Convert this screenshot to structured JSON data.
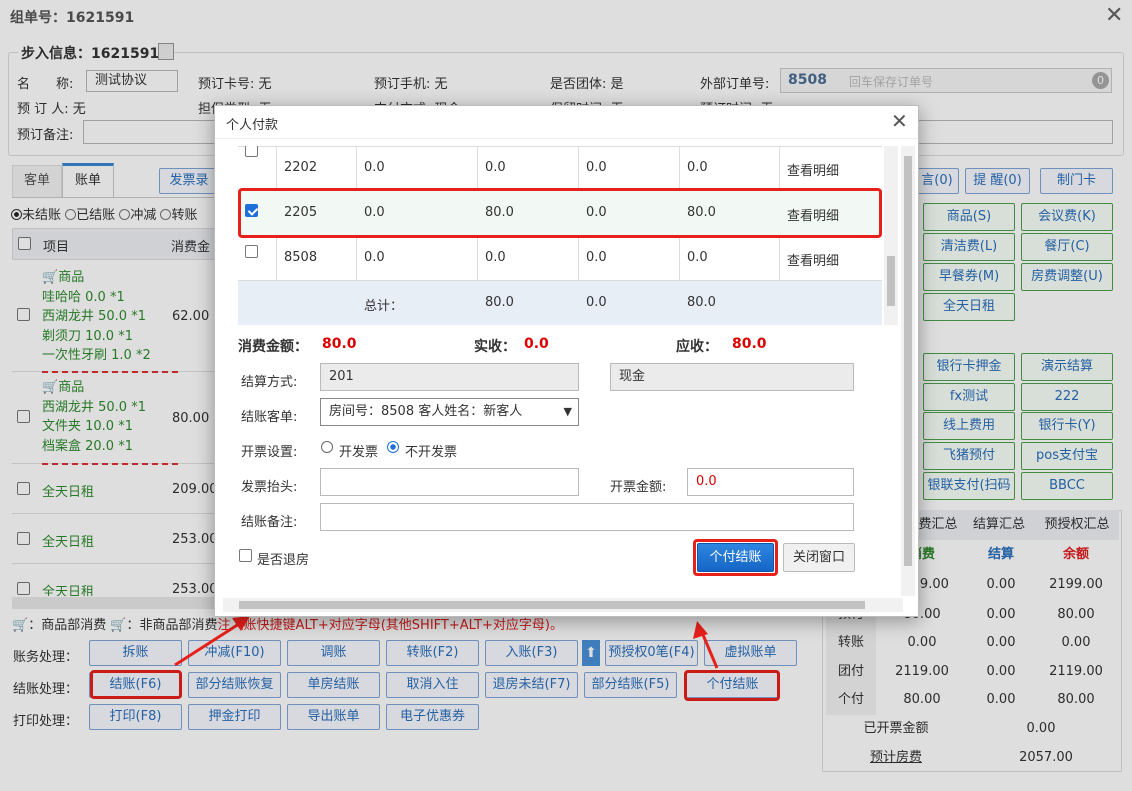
{
  "window": {
    "title": "组单号：1621591"
  },
  "checkin": {
    "section_title": "步入信息：1621591",
    "name_label": "名　　称:",
    "name_value": "测试协议",
    "card_label": "预订卡号: 无",
    "mobile_label": "预订手机: 无",
    "group_label": "是否团体: 是",
    "ext_order_label": "外部订单号:",
    "ext_order_value": "8508",
    "ext_order_placeholder": "回车保存订单号",
    "ext_badge": "0",
    "booker_label": "预 订 人: 无",
    "guarantee_label": "担保类型: 无",
    "pay_label": "支付方式: 现金",
    "keep_label": "保留时间: 无",
    "arrive_label": "预订时间: 无",
    "remark_label": "预订备注:"
  },
  "tabs": [
    {
      "label": "客单"
    },
    {
      "label": "账单"
    }
  ],
  "invoice_btn": "发票录",
  "filters": [
    "未结账",
    "已结账",
    "冲减",
    "转账"
  ],
  "bill_table": {
    "col_item": "项目",
    "col_amount": "消费金",
    "rows": [
      {
        "type": "商品",
        "lines": [
          "哇哈哈 0.0 *1",
          "西湖龙井 50.0 *1",
          "剃须刀 10.0 *1",
          "一次性牙刷 1.0 *2"
        ],
        "amount": "62.00"
      },
      {
        "type": "商品",
        "lines": [
          "西湖龙井 50.0 *1",
          "文件夹 10.0 *1",
          "档案盒 20.0 *1"
        ],
        "amount": "80.00"
      },
      {
        "title": "全天日租",
        "amount": "209.00"
      },
      {
        "title": "全天日租",
        "amount": "253.00"
      },
      {
        "title": "全天日租",
        "amount": "253.00"
      }
    ]
  },
  "legend_text": "：商品部消费",
  "legend_text2": "：非商品部消费",
  "hint": "注入账快捷键ALT+对应字母(其他SHIFT+ALT+对应字母)。",
  "ops": {
    "acct_label": "账务处理：",
    "acct_buttons": [
      "拆账",
      "冲减(F10)",
      "调账",
      "转账(F2)",
      "入账(F3)",
      "预授权0笔(F4)",
      "虚拟账单"
    ],
    "settle_label": "结账处理：",
    "settle_buttons": [
      "结账(F6)",
      "部分结账恢复",
      "单房结账",
      "取消入住",
      "退房未结(F7)",
      "部分结账(F5)",
      "个付结账"
    ],
    "print_label": "打印处理：",
    "print_buttons": [
      "打印(F8)",
      "押金打印",
      "导出账单",
      "电子优惠券"
    ]
  },
  "right_panel": {
    "top_buttons": [
      "言(0)",
      "提 醒(0)",
      "制门卡"
    ],
    "grid_buttons": [
      "商品(S)",
      "会议费(K)",
      "清洁费(L)",
      "餐厅(C)",
      "早餐券(M)",
      "房费调整(U)",
      "全天日租"
    ],
    "pay_buttons": [
      "银行卡押金",
      "演示结算",
      "fx测试",
      "222",
      "线上费用",
      "银行卡(Y)",
      "飞猪预付",
      "pos支付宝",
      "银联支付(扫码",
      "BBCC"
    ],
    "summary_tabs": [
      "消费汇总",
      "结算汇总",
      "预授权汇总"
    ],
    "summary_headers": [
      "消费",
      "结算",
      "余额"
    ],
    "summary_rows": [
      {
        "label": "",
        "values": [
          "2199.00",
          "0.00",
          "2199.00"
        ]
      },
      {
        "label": "预付",
        "values": [
          "80.00",
          "0.00",
          "80.00"
        ]
      },
      {
        "label": "转账",
        "values": [
          "0.00",
          "0.00",
          "0.00"
        ]
      },
      {
        "label": "团付",
        "values": [
          "2119.00",
          "0.00",
          "2119.00"
        ]
      },
      {
        "label": "个付",
        "values": [
          "80.00",
          "0.00",
          "80.00"
        ]
      }
    ],
    "invoiced_label": "已开票金额",
    "invoiced_value": "0.00",
    "est_label": "预计房费",
    "est_value": "2057.00"
  },
  "modal": {
    "title": "个人付款",
    "rows": [
      {
        "room": "2202",
        "c1": "0.0",
        "c2": "0.0",
        "c3": "0.0",
        "c4": "0.0",
        "link": "查看明细",
        "checked": false
      },
      {
        "room": "2205",
        "c1": "0.0",
        "c2": "80.0",
        "c3": "0.0",
        "c4": "80.0",
        "link": "查看明细",
        "checked": true
      },
      {
        "room": "8508",
        "c1": "0.0",
        "c2": "0.0",
        "c3": "0.0",
        "c4": "0.0",
        "link": "查看明细",
        "checked": false
      }
    ],
    "total_label": "总计：",
    "total_c2": "80.0",
    "total_c3": "0.0",
    "total_c4": "80.0",
    "consume_label": "消费金额：",
    "consume_value": "80.0",
    "received_label": "实收：",
    "received_value": "0.0",
    "due_label": "应收：",
    "due_value": "80.0",
    "method_label": "结算方式:",
    "method_code": "201",
    "method_name": "现金",
    "guest_label": "结账客单:",
    "guest_value": "房间号：8508 客人姓名：新客人",
    "invoice_setting_label": "开票设置:",
    "invoice_opt1": "开发票",
    "invoice_opt2": "不开发票",
    "invoice_title_label": "发票抬头:",
    "invoice_amount_label": "开票金额:",
    "invoice_amount_value": "0.0",
    "remark_label": "结账备注:",
    "checkout_label": "是否退房",
    "pay_btn": "个付结账",
    "close_btn": "关闭窗口"
  }
}
